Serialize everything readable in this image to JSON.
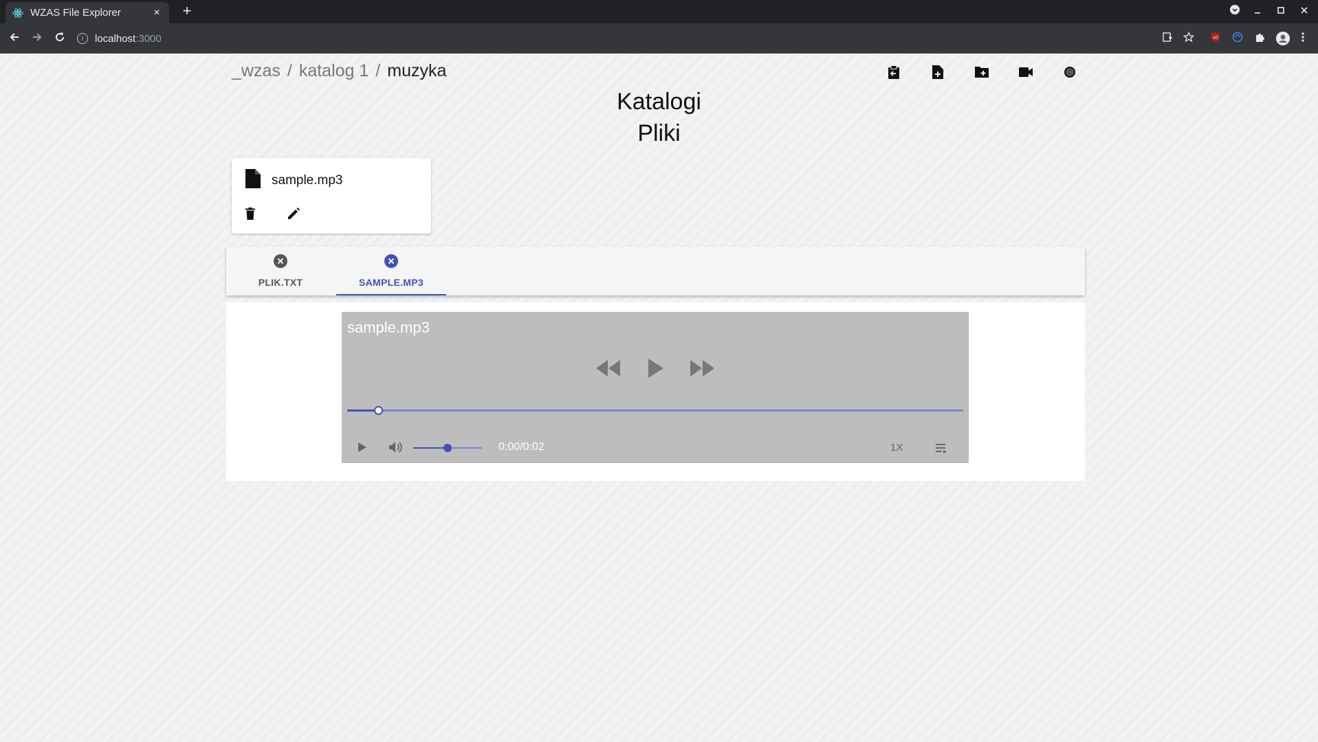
{
  "browser": {
    "tab_title": "WZAS File Explorer",
    "tab_close": "×",
    "new_tab": "+",
    "url_host": "localhost",
    "url_port": ":3000"
  },
  "breadcrumb": {
    "items": [
      "_wzas",
      "katalog 1",
      "muzyka"
    ],
    "separator": "/"
  },
  "headings": {
    "folders": "Katalogi",
    "files": "Pliki"
  },
  "file_card": {
    "name": "sample.mp3"
  },
  "tabs": [
    {
      "label": "PLIK.TXT",
      "active": false
    },
    {
      "label": "SAMPLE.MP3",
      "active": true
    }
  ],
  "player": {
    "title": "sample.mp3",
    "time": "0:00/0:02",
    "speed": "1X",
    "progress_fraction": 0.05,
    "volume_fraction": 0.5
  },
  "colors": {
    "accent": "#3f51b5",
    "player_bg": "#bdbdbd",
    "browser_dark": "#202124"
  }
}
